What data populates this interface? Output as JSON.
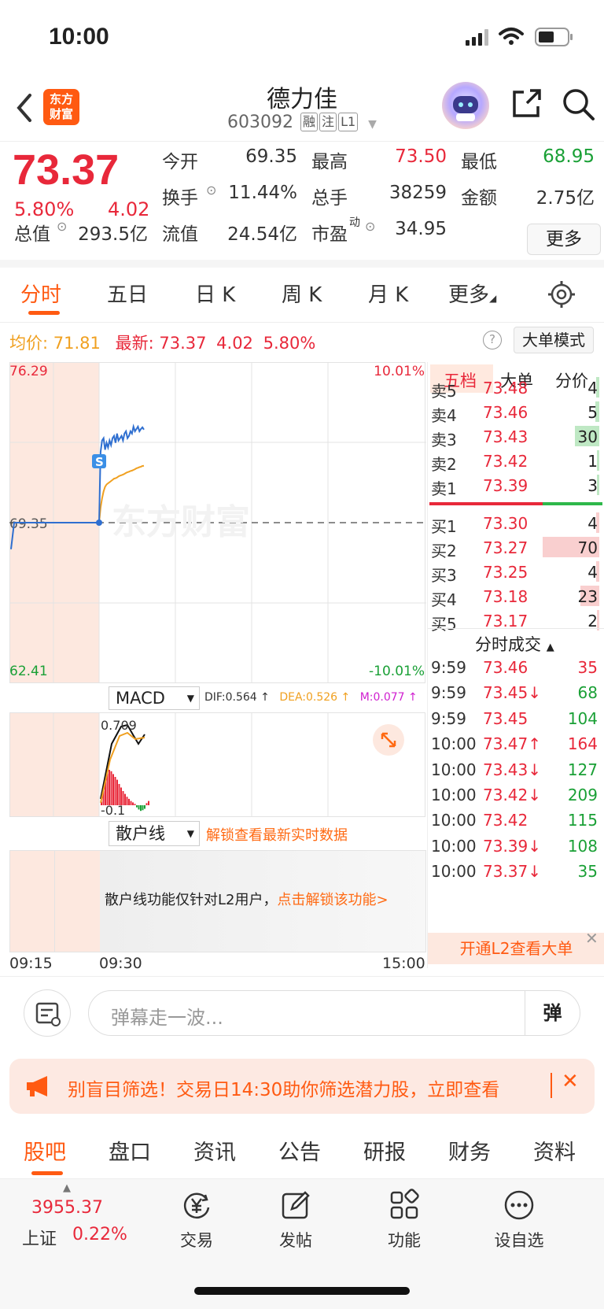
{
  "status": {
    "time": "10:00"
  },
  "header": {
    "logo": [
      "东方",
      "财富"
    ],
    "name": "德力佳",
    "code": "603092",
    "tags": [
      "融",
      "注",
      "L1"
    ]
  },
  "quote": {
    "price": "73.37",
    "pct": "5.80%",
    "change": "4.02",
    "stats": {
      "open_label": "今开",
      "open": "69.35",
      "high_label": "最高",
      "high": "73.50",
      "low_label": "最低",
      "low": "68.95",
      "turnover_label": "换手",
      "turnover": "11.44%",
      "volume_label": "总手",
      "volume": "38259",
      "amount_label": "金额",
      "amount": "2.75亿",
      "mktcap_label": "总值",
      "mktcap": "293.5亿",
      "float_label": "流值",
      "float": "24.54亿",
      "pe_label": "市盈",
      "pe_sup": "动",
      "pe": "34.95"
    },
    "more": "更多"
  },
  "chart_tabs": [
    "分时",
    "五日",
    "日 K",
    "周 K",
    "月 K",
    "更多"
  ],
  "avg_row": {
    "avg_label": "均价:",
    "avg": "71.81",
    "last_label": "最新:",
    "last": "73.37",
    "chg": "4.02",
    "pct": "5.80%"
  },
  "big_order_mode": "大单模式",
  "chart": {
    "ymax": "76.29",
    "ymin": "62.41",
    "ref": "69.35",
    "pct_max": "10.01%",
    "pct_min": "-10.01%",
    "marker": "S",
    "watermark": "东方财富",
    "x_labels": [
      "09:15",
      "09:30",
      "15:00"
    ]
  },
  "chart_data": {
    "type": "line",
    "x": [
      "09:15",
      "09:20",
      "09:25",
      "09:30",
      "09:31",
      "09:32",
      "09:33",
      "09:34",
      "09:35",
      "09:36",
      "09:37",
      "09:38",
      "09:39",
      "09:40",
      "09:41",
      "09:42",
      "09:43",
      "09:44",
      "09:45",
      "09:46",
      "09:47",
      "09:48",
      "09:49",
      "09:50",
      "09:51",
      "09:52",
      "09:53",
      "09:54",
      "09:55",
      "09:56",
      "09:57",
      "09:58",
      "09:59",
      "10:00"
    ],
    "series": [
      {
        "values": [
          68.2,
          69.35,
          69.35,
          69.35,
          72.4,
          72.9,
          73.0,
          72.5,
          72.8,
          72.6,
          72.9,
          72.7,
          73.0,
          73.1,
          72.8,
          73.2,
          72.9,
          73.0,
          73.1,
          72.9,
          73.2,
          73.3,
          73.0,
          73.1,
          73.3,
          73.2,
          73.5,
          73.3,
          73.4,
          73.5,
          73.3,
          73.4,
          73.47,
          73.37
        ]
      },
      {
        "values": [
          null,
          null,
          null,
          69.35,
          70.0,
          70.4,
          70.7,
          70.9,
          71.0,
          71.05,
          71.1,
          71.15,
          71.2,
          71.25,
          71.27,
          71.3,
          71.35,
          71.38,
          71.4,
          71.43,
          71.46,
          71.5,
          71.53,
          71.55,
          71.58,
          71.6,
          71.63,
          71.66,
          71.7,
          71.72,
          71.75,
          71.77,
          71.8,
          71.81
        ]
      }
    ],
    "ylim": [
      62.41,
      76.29
    ]
  },
  "macd": {
    "label": "MACD",
    "dif": "DIF:0.564 ↑",
    "dea": "DEA:0.526 ↑",
    "m": "M:0.077 ↑",
    "top": "0.709",
    "bottom": "-0.1",
    "hist": [
      0.05,
      0.2,
      0.35,
      0.45,
      0.5,
      0.48,
      0.44,
      0.4,
      0.36,
      0.3,
      0.25,
      0.2,
      0.16,
      0.12,
      0.09,
      0.06,
      0.04,
      0.02,
      -0.03,
      -0.06,
      -0.08,
      -0.07,
      -0.05,
      0.03,
      0.06
    ]
  },
  "retail": {
    "label": "散户线",
    "unlock": "解锁查看最新实时数据",
    "notice": "散户线功能仅针对L2用户，",
    "notice_link": "点击解锁该功能>"
  },
  "book": {
    "tabs": [
      "五档",
      "大单",
      "分价"
    ],
    "asks": [
      {
        "label": "卖5",
        "price": "73.48",
        "qty": "4",
        "bar": 0.06
      },
      {
        "label": "卖4",
        "price": "73.46",
        "qty": "5",
        "bar": 0.07
      },
      {
        "label": "卖3",
        "price": "73.43",
        "qty": "30",
        "bar": 0.43
      },
      {
        "label": "卖2",
        "price": "73.42",
        "qty": "1",
        "bar": 0.02
      },
      {
        "label": "卖1",
        "price": "73.39",
        "qty": "3",
        "bar": 0.04
      }
    ],
    "bids": [
      {
        "label": "买1",
        "price": "73.30",
        "qty": "4",
        "bar": 0.06
      },
      {
        "label": "买2",
        "price": "73.27",
        "qty": "70",
        "bar": 1.0
      },
      {
        "label": "买3",
        "price": "73.25",
        "qty": "4",
        "bar": 0.06
      },
      {
        "label": "买4",
        "price": "73.18",
        "qty": "23",
        "bar": 0.33
      },
      {
        "label": "买5",
        "price": "73.17",
        "qty": "2",
        "bar": 0.03
      }
    ],
    "trades_title": "分时成交",
    "trades": [
      {
        "t": "9:59",
        "p": "73.46",
        "q": "35",
        "pc": "red",
        "qc": "red"
      },
      {
        "t": "9:59",
        "p": "73.45↓",
        "q": "68",
        "pc": "red",
        "qc": "green"
      },
      {
        "t": "9:59",
        "p": "73.45",
        "q": "104",
        "pc": "red",
        "qc": "green"
      },
      {
        "t": "10:00",
        "p": "73.47↑",
        "q": "164",
        "pc": "red",
        "qc": "red"
      },
      {
        "t": "10:00",
        "p": "73.43↓",
        "q": "127",
        "pc": "red",
        "qc": "green"
      },
      {
        "t": "10:00",
        "p": "73.42↓",
        "q": "209",
        "pc": "red",
        "qc": "green"
      },
      {
        "t": "10:00",
        "p": "73.42",
        "q": "115",
        "pc": "red",
        "qc": "green"
      },
      {
        "t": "10:00",
        "p": "73.39↓",
        "q": "108",
        "pc": "red",
        "qc": "green"
      },
      {
        "t": "10:00",
        "p": "73.37↓",
        "q": "35",
        "pc": "red",
        "qc": "green"
      }
    ],
    "l2_cta": "开通L2查看大单"
  },
  "danmu": {
    "placeholder": "弹幕走一波...",
    "button": "弹"
  },
  "promo": "别盲目筛选！交易日14:30助你筛选潜力股，立即查看",
  "content_tabs": [
    "股吧",
    "盘口",
    "资讯",
    "公告",
    "研报",
    "财务",
    "资料"
  ],
  "bottom": {
    "index_value": "3955.37",
    "index_name": "上证",
    "index_pct": "0.22%",
    "items": [
      "交易",
      "发帖",
      "功能",
      "设自选"
    ]
  },
  "colors": {
    "up": "#e8283a",
    "down": "#1aa036",
    "accent": "#ff5a12",
    "price_line": "#2f6fd0",
    "avg_line": "#f0a020"
  }
}
